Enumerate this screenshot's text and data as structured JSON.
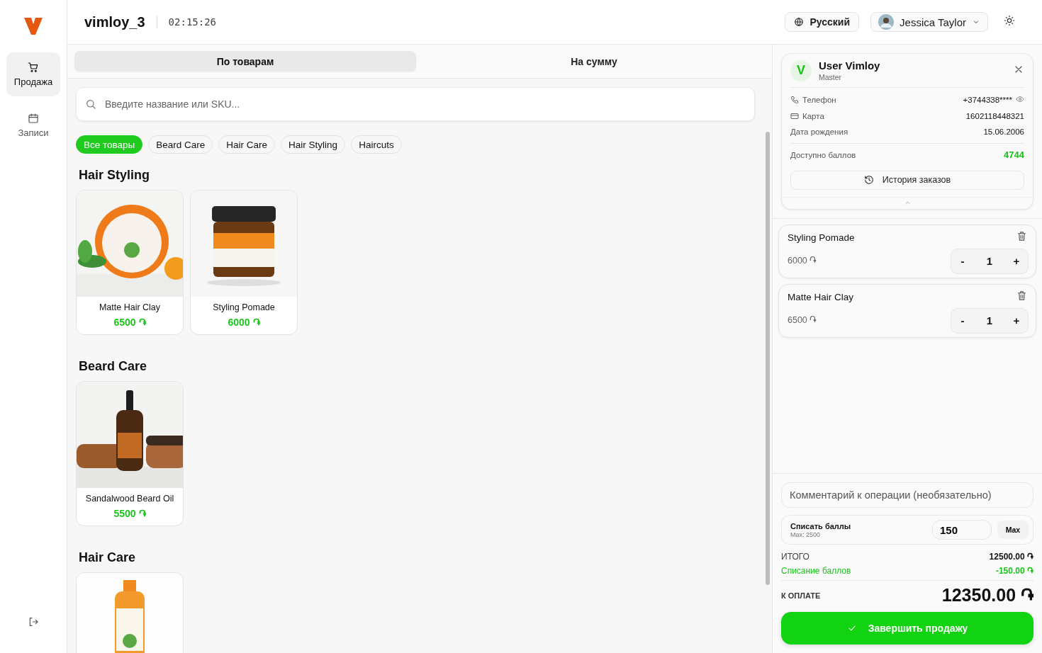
{
  "sidebar": {
    "items": [
      {
        "label": "Продажа",
        "kind": "cart",
        "selected": true
      },
      {
        "label": "Записи",
        "kind": "calendar",
        "selected": false
      }
    ]
  },
  "header": {
    "title": "vimloy_3",
    "time": "02:15:26",
    "language": "Русский",
    "user": "Jessica Taylor"
  },
  "tabs": [
    {
      "label": "По товарам",
      "selected": true
    },
    {
      "label": "На сумму",
      "selected": false
    }
  ],
  "search": {
    "placeholder": "Введите название или SKU..."
  },
  "filters": [
    {
      "label": "Все товары",
      "selected": true
    },
    {
      "label": "Beard Care",
      "selected": false
    },
    {
      "label": "Hair Care",
      "selected": false
    },
    {
      "label": "Hair Styling",
      "selected": false
    },
    {
      "label": "Haircuts",
      "selected": false
    }
  ],
  "sections": [
    {
      "title": "Hair Styling",
      "products": [
        {
          "name": "Matte Hair Clay",
          "price": "6500 ֏"
        },
        {
          "name": "Styling Pomade",
          "price": "6000 ֏"
        }
      ]
    },
    {
      "title": "Beard Care",
      "products": [
        {
          "name": "Sandalwood Beard Oil",
          "price": "5500 ֏"
        }
      ]
    },
    {
      "title": "Hair Care"
    }
  ],
  "client": {
    "initial": "V",
    "name": "User Vimloy",
    "role": "Master",
    "rows": [
      {
        "kind": "phone",
        "label": "Телефон",
        "value": "+3744338****"
      },
      {
        "kind": "card",
        "label": "Карта",
        "value": "1602118448321"
      },
      {
        "kind": "plain",
        "label": "Дата рождения",
        "value": "15.06.2006"
      }
    ],
    "points_label": "Доступно баллов",
    "points": "4744",
    "history_button": "История заказов"
  },
  "cart": [
    {
      "name": "Styling Pomade",
      "price": "6000 ֏",
      "quantity": "1",
      "minus": "-",
      "plus": "+"
    },
    {
      "name": "Matte Hair Clay",
      "price": "6500 ֏",
      "quantity": "1",
      "minus": "-",
      "plus": "+"
    }
  ],
  "comment": {
    "placeholder": "Комментарий к операции (необязательно)"
  },
  "redeem": {
    "label": "Списать баллы",
    "hint": "Max: 2500",
    "value": "150",
    "max_button": "Max"
  },
  "totals": [
    {
      "kind": "normal",
      "label": "ИТОГО",
      "value": "12500.00 ֏"
    },
    {
      "kind": "discount",
      "label": "Списание баллов",
      "value": "-150.00 ֏"
    }
  ],
  "due": {
    "label": "К ОПЛАТЕ",
    "value": "12350.00 ֏"
  },
  "complete_button": "Завершить продажу"
}
